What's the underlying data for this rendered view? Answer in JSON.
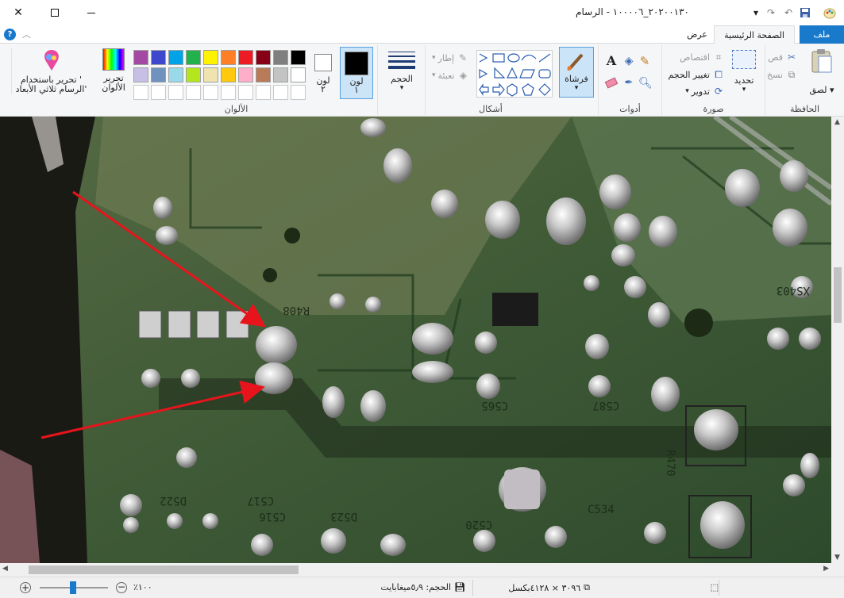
{
  "window": {
    "title": "٢٠٢٠٠١٣٠_١٠٠٠٠٦ - الرسام",
    "minimize_icon": "minimize-icon",
    "maximize_icon": "maximize-icon",
    "close_icon": "close-icon"
  },
  "tabs": {
    "file": "ملف",
    "home": "الصفحة الرئيسية",
    "view": "عرض"
  },
  "clipboard": {
    "label": "الحافظة",
    "paste": "لصق",
    "cut": "قص",
    "copy": "نسخ"
  },
  "image": {
    "label": "صورة",
    "select": "تحديد",
    "crop": "اقتصاص",
    "resize": "تغيير الحجم",
    "rotate": "تدوير"
  },
  "tools": {
    "label": "أدوات"
  },
  "brushes": {
    "label": "فرشاة"
  },
  "shapes": {
    "label": "أشكال",
    "outline": "إطار",
    "fill": "تعبئة"
  },
  "size": {
    "label": "الحجم"
  },
  "colors": {
    "label": "الألوان",
    "color1": "لون\n١",
    "color2": "لون\n٢",
    "edit_colors": "تحرير\nالألوان",
    "paint3d": "تحرير باستخدام '\nالرسام ثلاثي الأبعاد'",
    "color1_value": "#000000",
    "color2_value": "#ffffff",
    "palette_row1": [
      "#000000",
      "#7f7f7f",
      "#880015",
      "#ed1c24",
      "#ff7f27",
      "#fff200",
      "#22b14c",
      "#00a2e8",
      "#3f48cc",
      "#a349a4"
    ],
    "palette_row2": [
      "#ffffff",
      "#c3c3c3",
      "#b97a57",
      "#ffaec9",
      "#ffc90e",
      "#efe4b0",
      "#b5e61d",
      "#99d9ea",
      "#7092be",
      "#c8bfe7"
    ]
  },
  "status": {
    "dimensions": "٣٠٩٦ × ٤١٢٨بكسل",
    "file_size": "الحجم: ٥٫٩ميغابايت",
    "zoom": "١٠٠٪"
  }
}
